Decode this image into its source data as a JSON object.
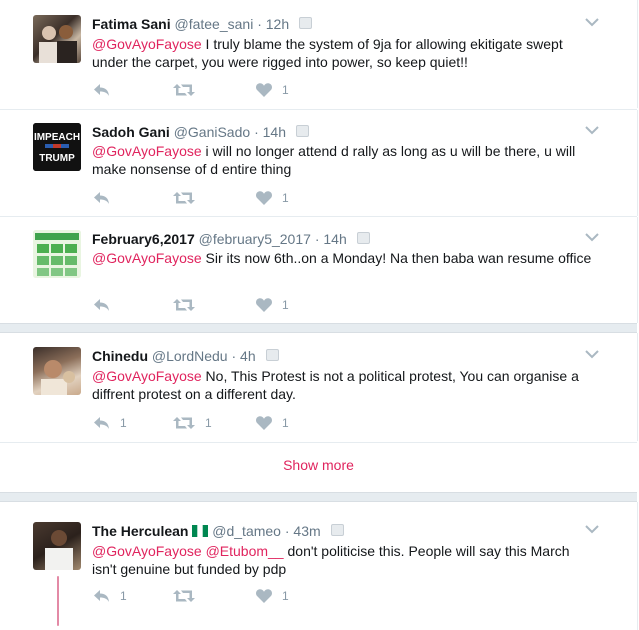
{
  "tweets": [
    {
      "name": "Fatima Sani",
      "handle": "@fatee_sani",
      "time": "12h",
      "mention": "@GovAyoFayose",
      "text": "  I truly blame the system of 9ja for allowing ekitigate swept under the carpet, you were rigged  into power, so keep quiet!!",
      "retweets": "",
      "likes": "1"
    },
    {
      "name": "Sadoh Gani",
      "handle": "@GaniSado",
      "time": "14h",
      "mention": "@GovAyoFayose",
      "text": " i will no longer attend d rally as long as u will be there, u will make nonsense of d entire thing",
      "retweets": "",
      "likes": "1",
      "avatar_lines": [
        "IMPEACH",
        "TRUMP"
      ]
    },
    {
      "name": "February6,2017",
      "handle": "@february5_2017",
      "time": "14h",
      "mention": "@GovAyoFayose",
      "text": " Sir its now 6th..on a Monday! Na then baba wan resume office",
      "retweets": "",
      "likes": "1"
    },
    {
      "name": "Chinedu",
      "handle": "@LordNedu",
      "time": "4h",
      "mention": "@GovAyoFayose",
      "text": " No, This Protest is not a political protest, You can organise a diffrent protest on a different day.",
      "replies": "1",
      "retweets": "1",
      "likes": "1"
    },
    {
      "name": "The Herculean",
      "handle": "@d_tameo",
      "time": "43m",
      "mention": "@GovAyoFayose",
      "mention2": "@Etubom__",
      "text": " don't politicise this. People will say this March isn't genuine but funded by pdp",
      "replies": "1",
      "retweets": "",
      "likes": "1"
    }
  ],
  "show_more": "Show more",
  "dot": "·",
  "colors": {
    "mention": "#e0245e",
    "action_icon": "#aab8c2",
    "text_secondary": "#657786"
  },
  "icons": [
    "reply-icon",
    "retweet-icon",
    "like-icon",
    "chevron-down-icon",
    "nigeria-flag-icon"
  ]
}
